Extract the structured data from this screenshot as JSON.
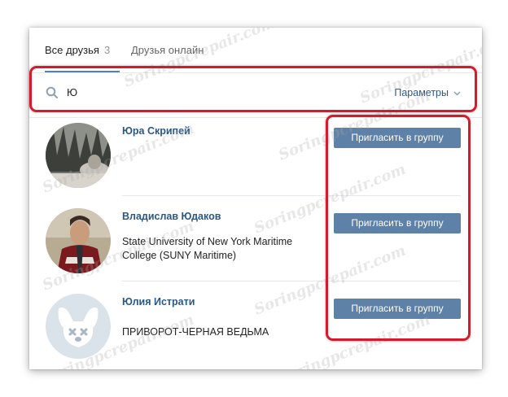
{
  "tabs": [
    {
      "label": "Все друзья",
      "count": "3",
      "active": true
    },
    {
      "label": "Друзья онлайн",
      "active": false
    }
  ],
  "search": {
    "value": "Ю",
    "icon": "search-icon"
  },
  "params": {
    "label": "Параметры",
    "icon": "chevron-down-icon"
  },
  "friends": [
    {
      "name": "Юра Скрипей",
      "desc": "",
      "button": "Пригласить в группу"
    },
    {
      "name": "Владислав Юдаков",
      "desc": "State University of New York Maritime College (SUNY Maritime)",
      "button": "Пригласить в группу"
    },
    {
      "name": "Юлия Истрати",
      "desc": "ПРИВОРОТ-ЧЕРНАЯ ВЕДЬМА",
      "button": "Пригласить в группу"
    }
  ],
  "watermark": "Soringpcrepair.com",
  "colors": {
    "accent": "#5181b8",
    "button": "#5e81a8",
    "highlight": "#d8192b",
    "link": "#2a5885"
  }
}
